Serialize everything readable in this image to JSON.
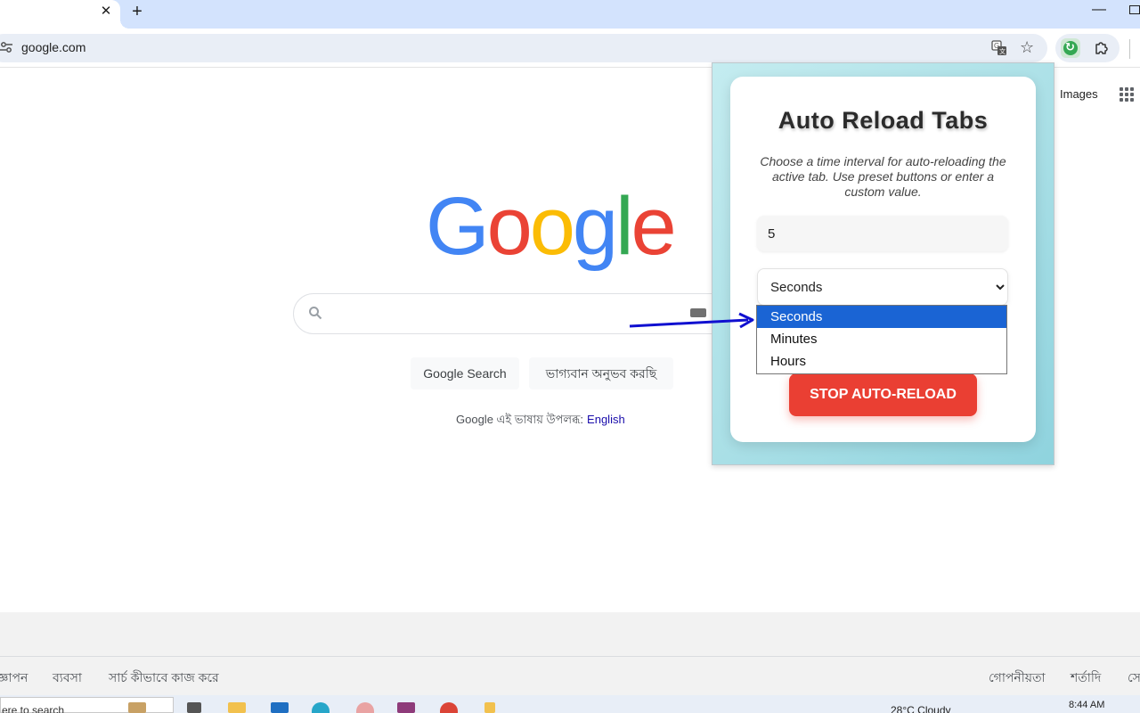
{
  "browser": {
    "tab_close": "✕",
    "new_tab": "+",
    "minimize": "—",
    "url": "google.com"
  },
  "google": {
    "header_images": "Images",
    "logo": [
      "G",
      "o",
      "o",
      "g",
      "l",
      "e"
    ],
    "search_button": "Google Search",
    "lucky_button": "ভাগ্যবান অনুভব করছি",
    "offered_in": "Google এই ভাষায় উপলব্ধ:",
    "language_link": "English",
    "footer_links": [
      "জ্ঞাপন",
      "ব্যবসা",
      "সার্চ কীভাবে কাজ করে",
      "গোপনীয়তা",
      "শর্তাদি",
      "সে"
    ]
  },
  "extension": {
    "title": "Auto Reload Tabs",
    "description": "Choose a time interval for auto-reloading the active tab. Use preset buttons or enter a custom value.",
    "interval_value": "5",
    "unit_selected": "Seconds",
    "unit_options": [
      "Seconds",
      "Minutes",
      "Hours"
    ],
    "stop_button": "STOP AUTO-RELOAD"
  },
  "taskbar": {
    "search_text": "ere to search",
    "weather": "28°C  Cloudy",
    "time": "8:44 AM"
  },
  "colors": {
    "accent_blue": "#1a64d4",
    "stop_red": "#ea3f33",
    "popup_gradient": "#a9dfe6"
  }
}
